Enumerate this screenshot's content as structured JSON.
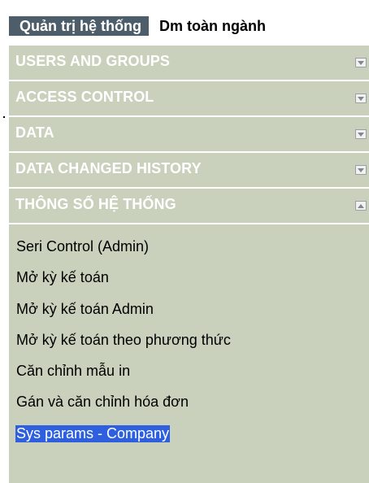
{
  "tabs": [
    {
      "label": "Quản trị hệ thống",
      "active": true
    },
    {
      "label": "Dm toàn ngành",
      "active": false
    }
  ],
  "sections": [
    {
      "label": "USERS AND GROUPS",
      "state": "collapsed",
      "toggle_icon": "expand-down-icon"
    },
    {
      "label": "ACCESS CONTROL",
      "state": "collapsed",
      "toggle_icon": "expand-down-icon"
    },
    {
      "label": "DATA",
      "state": "collapsed",
      "toggle_icon": "expand-down-icon"
    },
    {
      "label": "DATA CHANGED HISTORY",
      "state": "collapsed",
      "toggle_icon": "expand-down-icon"
    },
    {
      "label": "THÔNG SỐ HỆ THỐNG",
      "state": "expanded",
      "toggle_icon": "collapse-up-icon"
    }
  ],
  "menu": [
    {
      "label": "Seri Control (Admin)"
    },
    {
      "label": "Mở kỳ kế toán"
    },
    {
      "label": "Mở kỳ kế toán Admin"
    },
    {
      "label": "Mở kỳ kế toán theo phương thức"
    },
    {
      "label": "Căn chỉnh mẫu in"
    },
    {
      "label": "Gán và căn chỉnh hóa đơn"
    },
    {
      "label": "Sys params - Company",
      "selected": true
    }
  ],
  "colors": {
    "panel_bg": "#c9d1bc",
    "active_tab_bg": "#4d5e6a",
    "selection_bg": "#2d5fdf"
  }
}
